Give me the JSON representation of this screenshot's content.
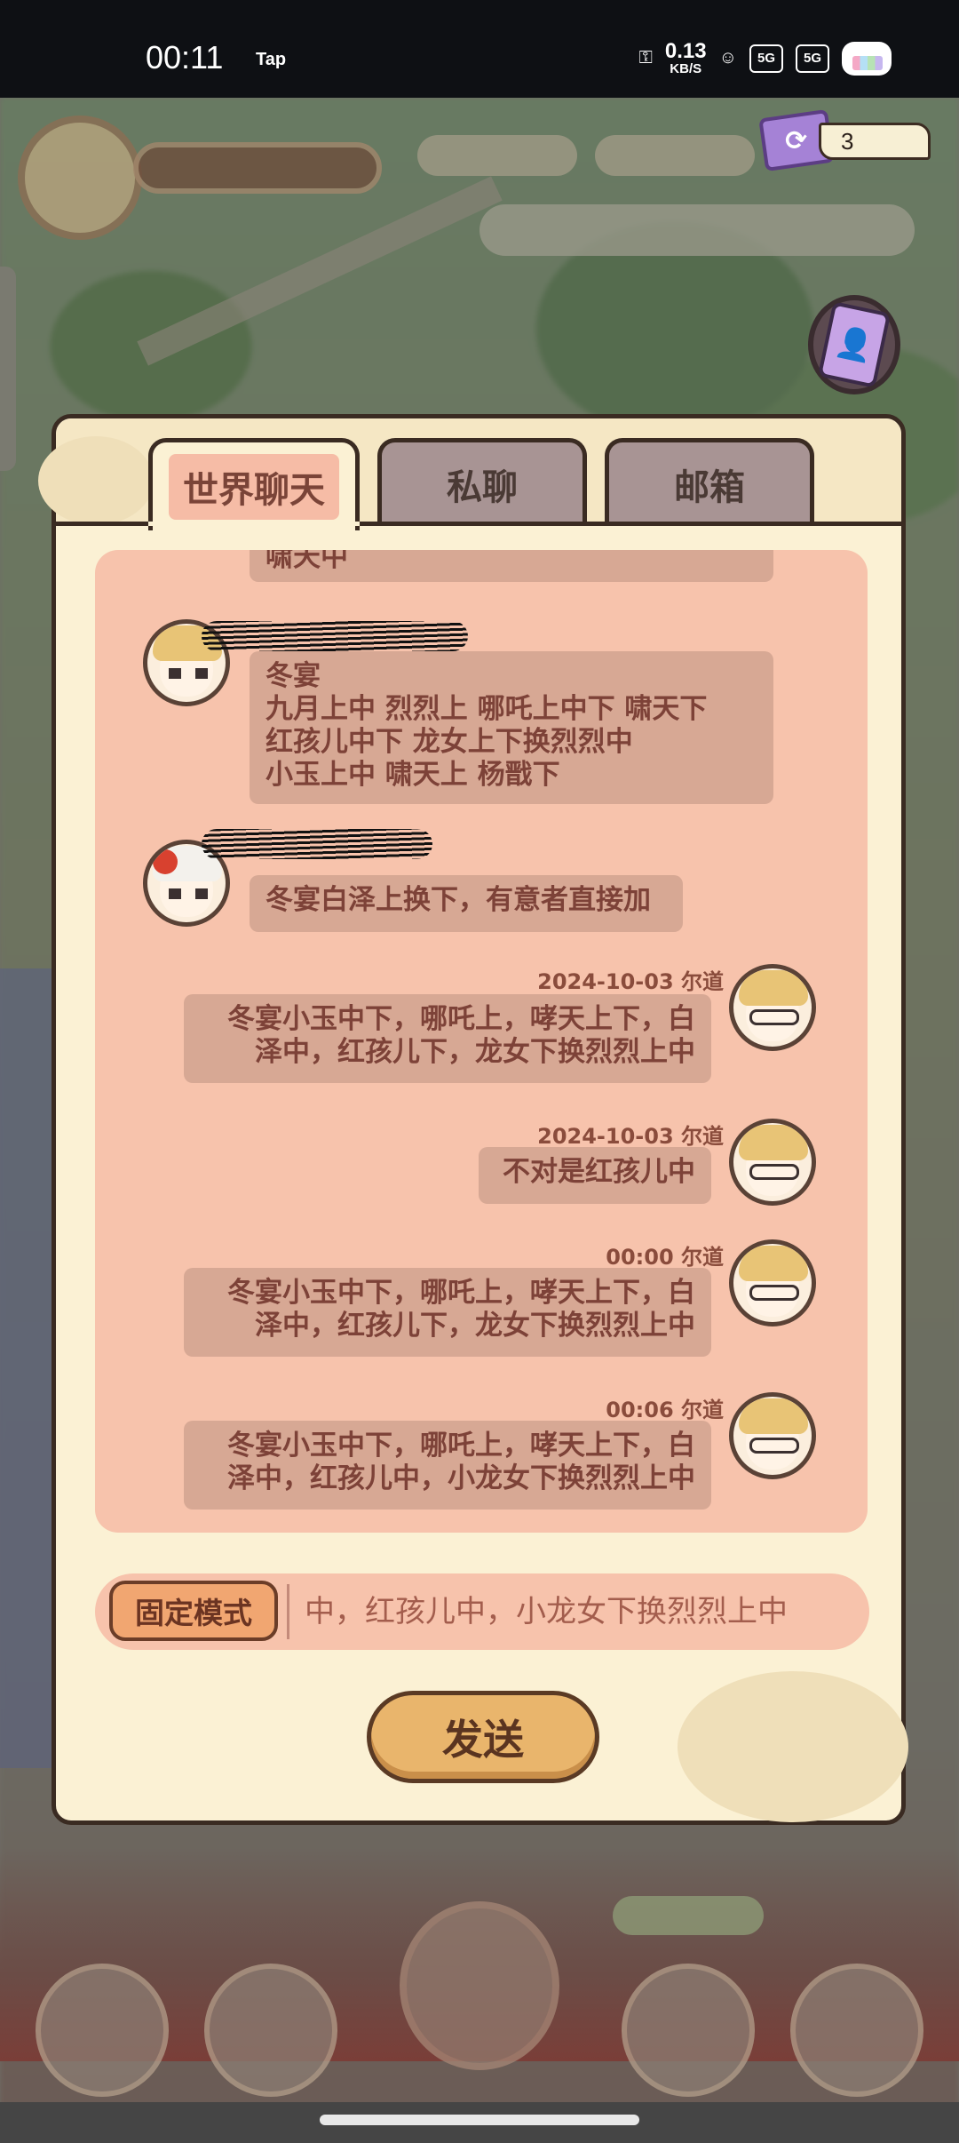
{
  "status_bar": {
    "time": "00:11",
    "app": "Tap",
    "net_speed_value": "0.13",
    "net_speed_unit": "KB/S",
    "signal_1": "5G",
    "signal_2": "5G"
  },
  "hud": {
    "ticket_count": "3"
  },
  "tabs": [
    {
      "label": "世界聊天",
      "active": true
    },
    {
      "label": "私聊",
      "active": false
    },
    {
      "label": "邮箱",
      "active": false
    }
  ],
  "messages": [
    {
      "side": "left",
      "text_lines": [
        "冬宴",
        "九月上中 烈烈上 哪吒上中下 啸天下",
        "红孩儿中下 龙女上下换烈烈中",
        "小玉上中 啸天上 杨戬下"
      ]
    },
    {
      "side": "left",
      "text_lines": [
        "冬宴白泽上换下，有意者直接加"
      ]
    },
    {
      "side": "right",
      "time": "2024-10-03 尔道",
      "text_lines": [
        "冬宴小玉中下，哪吒上，哮天上下，白",
        "泽中，红孩儿下，龙女下换烈烈上中"
      ]
    },
    {
      "side": "right",
      "time": "2024-10-03 尔道",
      "text_lines": [
        "不对是红孩儿中"
      ]
    },
    {
      "side": "right",
      "time": "00:00 尔道",
      "text_lines": [
        "冬宴小玉中下，哪吒上，哮天上下，白",
        "泽中，红孩儿下，龙女下换烈烈上中"
      ]
    },
    {
      "side": "right",
      "time": "00:06 尔道",
      "text_lines": [
        "冬宴小玉中下，哪吒上，哮天上下，白",
        "泽中，红孩儿中，小龙女下换烈烈上中"
      ]
    }
  ],
  "partial_top_message": "啸天中",
  "input": {
    "mode_label": "固定模式",
    "value": "中，红孩儿中，小龙女下换烈烈上中"
  },
  "send_label": "发送",
  "colors": {
    "panel_bg": "#fbf1d4",
    "chat_bg": "#f7c3ac",
    "bubble_bg": "#d7a894",
    "bubble_text": "#7d4238",
    "border_dark": "#3a2b22"
  }
}
